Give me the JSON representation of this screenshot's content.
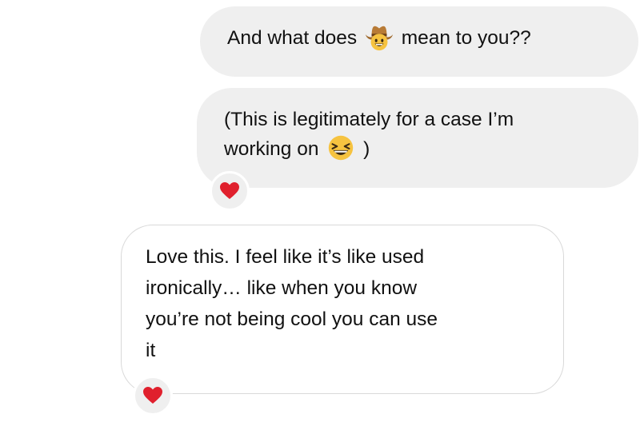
{
  "messages": [
    {
      "sender": "outgoing",
      "line1_before_emoji": "And what does",
      "emoji": "cowboy-face-emoji",
      "line1_after_emoji": "mean to you??"
    },
    {
      "sender": "outgoing",
      "line1": "(This is legitimately for a case I’m",
      "line2_before_emoji": "working on",
      "emoji": "laughing-face-emoji",
      "line2_after_emoji": ")",
      "reaction": "heart-reaction-icon"
    },
    {
      "sender": "incoming",
      "lines": [
        "Love this. I feel like it’s like used",
        "ironically… like when you know",
        "you’re not being cool you can use",
        "it"
      ],
      "reaction": "heart-reaction-icon"
    }
  ],
  "colors": {
    "outgoing_bubble": "#efefef",
    "incoming_border": "#d9d9d9",
    "heart": "#e0202d",
    "text": "#111111"
  }
}
